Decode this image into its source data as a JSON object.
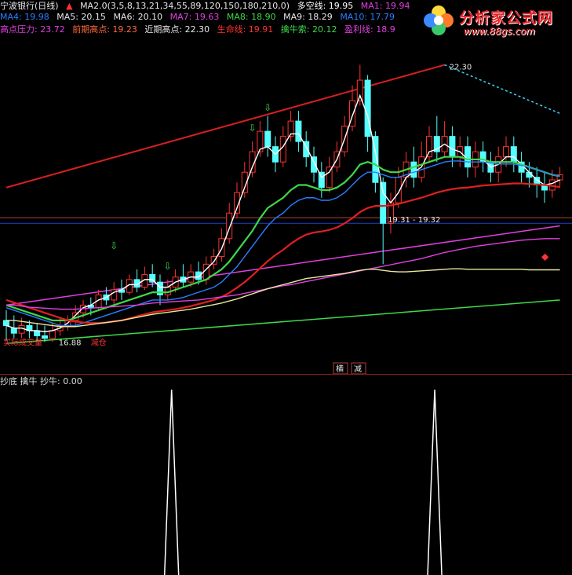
{
  "header": {
    "stock_title": "宁波银行(日线)",
    "indicator_name": "MA2.0(3,5,8,13,21,34,55,89,120,150,180,210,0)",
    "duokong": "多空线: 19.95",
    "ma1": "MA1: 19.94",
    "ma4": "MA4: 19.98",
    "ma5": "MA5: 20.15",
    "ma6": "MA6: 20.10",
    "ma7": "MA7: 19.63",
    "ma8": "MA8: 18.90",
    "ma9": "MA9: 18.29",
    "ma10": "MA10: 17.79",
    "gaodian": "高点压力: 23.72",
    "qiqi": "前期高点: 19.23",
    "jinqi": "近期高点: 22.30",
    "shengming": "生命线: 19.91",
    "qinniusuo": "擒牛索: 20.12",
    "yingli": "盈利线: 18.9"
  },
  "annotations": {
    "peak_label": "22.30",
    "range_label": "19.31 - 19.32",
    "low_label": "16.88",
    "left_tag": "实际成交量",
    "right_tag": "减仓",
    "bottom_left_box": "横",
    "bottom_right_box": "减"
  },
  "subpanel": {
    "title": "抄底 擒牛 抄牛: 0.00"
  },
  "logo": {
    "title": "分析家公式网",
    "url": "www.88gs.com"
  },
  "colors": {
    "up": "#ff3232",
    "down": "#54ffff",
    "ma_white": "#ffffff",
    "ma_green": "#3fd84a",
    "ma_red": "#e02020",
    "ma_blue": "#2a7fff",
    "ma_magenta": "#e040e0",
    "ma_yellow": "#e8e8a0"
  },
  "chart_data": {
    "type": "candlestick",
    "title": "宁波银行(日线)",
    "price_range": [
      16.5,
      22.8
    ],
    "candles": [
      [
        17.3,
        17.2,
        17.5,
        16.9
      ],
      [
        17.15,
        17.05,
        17.4,
        16.95
      ],
      [
        17.05,
        17.2,
        17.35,
        16.95
      ],
      [
        17.2,
        17.1,
        17.3,
        16.95
      ],
      [
        17.1,
        17.0,
        17.25,
        16.9
      ],
      [
        17.0,
        16.95,
        17.2,
        16.88
      ],
      [
        16.95,
        17.1,
        17.25,
        16.88
      ],
      [
        17.1,
        17.2,
        17.35,
        17.0
      ],
      [
        17.2,
        17.3,
        17.4,
        17.1
      ],
      [
        17.3,
        17.45,
        17.6,
        17.2
      ],
      [
        17.45,
        17.6,
        17.7,
        17.35
      ],
      [
        17.6,
        17.55,
        17.75,
        17.4
      ],
      [
        17.55,
        17.8,
        17.9,
        17.5
      ],
      [
        17.8,
        17.7,
        17.95,
        17.6
      ],
      [
        17.7,
        17.9,
        18.05,
        17.6
      ],
      [
        17.9,
        17.85,
        18.1,
        17.7
      ],
      [
        17.85,
        18.1,
        18.2,
        17.8
      ],
      [
        18.1,
        17.95,
        18.3,
        17.85
      ],
      [
        17.95,
        18.2,
        18.35,
        17.9
      ],
      [
        18.2,
        18.05,
        18.4,
        17.95
      ],
      [
        18.05,
        17.8,
        18.2,
        17.6
      ],
      [
        17.8,
        17.95,
        18.1,
        17.7
      ],
      [
        17.95,
        18.15,
        18.3,
        17.85
      ],
      [
        18.15,
        18.05,
        18.4,
        17.95
      ],
      [
        18.05,
        18.25,
        18.4,
        17.95
      ],
      [
        18.25,
        18.1,
        18.45,
        18.0
      ],
      [
        18.1,
        18.4,
        18.55,
        18.0
      ],
      [
        18.4,
        18.55,
        18.7,
        18.3
      ],
      [
        18.55,
        18.9,
        19.1,
        18.45
      ],
      [
        18.9,
        19.4,
        19.6,
        18.8
      ],
      [
        19.4,
        19.8,
        20.0,
        19.3
      ],
      [
        19.8,
        20.2,
        20.4,
        19.7
      ],
      [
        20.2,
        20.6,
        20.8,
        20.1
      ],
      [
        20.6,
        21.0,
        21.2,
        20.5
      ],
      [
        21.0,
        20.7,
        21.3,
        20.5
      ],
      [
        20.7,
        20.4,
        20.9,
        20.2
      ],
      [
        20.4,
        20.9,
        21.1,
        20.3
      ],
      [
        20.9,
        21.2,
        21.4,
        20.8
      ],
      [
        21.2,
        20.8,
        21.4,
        20.6
      ],
      [
        20.8,
        20.5,
        21.0,
        20.3
      ],
      [
        20.5,
        20.2,
        20.7,
        20.0
      ],
      [
        20.2,
        19.9,
        20.4,
        19.7
      ],
      [
        19.9,
        20.3,
        20.5,
        19.8
      ],
      [
        20.3,
        20.6,
        20.8,
        20.2
      ],
      [
        20.6,
        21.1,
        21.3,
        20.5
      ],
      [
        21.1,
        21.6,
        21.9,
        21.0
      ],
      [
        21.6,
        22.0,
        22.3,
        21.5
      ],
      [
        22.0,
        20.9,
        22.1,
        20.6
      ],
      [
        20.9,
        20.0,
        21.0,
        19.8
      ],
      [
        20.0,
        19.2,
        20.1,
        18.4
      ],
      [
        19.2,
        19.6,
        19.8,
        19.0
      ],
      [
        19.6,
        20.1,
        20.3,
        19.5
      ],
      [
        20.1,
        20.4,
        20.6,
        19.9
      ],
      [
        20.4,
        20.1,
        20.7,
        19.9
      ],
      [
        20.1,
        20.5,
        20.8,
        20.0
      ],
      [
        20.5,
        20.9,
        21.1,
        20.4
      ],
      [
        20.9,
        20.6,
        21.3,
        20.4
      ],
      [
        20.6,
        20.9,
        21.2,
        20.5
      ],
      [
        20.9,
        20.5,
        21.1,
        20.3
      ],
      [
        20.5,
        20.7,
        20.9,
        20.3
      ],
      [
        20.7,
        20.3,
        20.9,
        20.1
      ],
      [
        20.3,
        20.6,
        20.8,
        20.1
      ],
      [
        20.6,
        20.4,
        20.8,
        20.2
      ],
      [
        20.4,
        20.2,
        20.6,
        20.0
      ],
      [
        20.2,
        20.5,
        20.7,
        20.0
      ],
      [
        20.5,
        20.7,
        20.9,
        20.3
      ],
      [
        20.7,
        20.4,
        20.9,
        20.2
      ],
      [
        20.4,
        20.2,
        20.6,
        20.0
      ],
      [
        20.2,
        20.1,
        20.4,
        19.9
      ],
      [
        20.1,
        19.95,
        20.3,
        19.7
      ],
      [
        19.95,
        19.85,
        20.2,
        19.6
      ],
      [
        19.85,
        20.05,
        20.25,
        19.7
      ],
      [
        20.05,
        20.15,
        20.3,
        19.9
      ]
    ],
    "series": [
      {
        "name": "多空线",
        "color": "#ffffff",
        "values": [
          17.2,
          17.15,
          17.15,
          17.1,
          17.1,
          17.08,
          17.1,
          17.15,
          17.25,
          17.4,
          17.55,
          17.6,
          17.7,
          17.75,
          17.85,
          17.9,
          18.0,
          18.0,
          18.1,
          18.1,
          17.95,
          17.95,
          18.05,
          18.1,
          18.15,
          18.15,
          18.3,
          18.45,
          18.7,
          19.1,
          19.5,
          19.9,
          20.3,
          20.65,
          20.7,
          20.55,
          20.7,
          20.95,
          20.95,
          20.7,
          20.4,
          20.1,
          20.2,
          20.45,
          20.85,
          21.3,
          21.7,
          21.3,
          20.6,
          19.8,
          19.6,
          19.8,
          20.1,
          20.2,
          20.3,
          20.6,
          20.65,
          20.75,
          20.65,
          20.6,
          20.45,
          20.45,
          20.45,
          20.3,
          20.35,
          20.5,
          20.5,
          20.35,
          20.2,
          20.05,
          19.95,
          19.98,
          20.05
        ]
      },
      {
        "name": "擒牛索",
        "color": "#3fd84a",
        "values": [
          17.6,
          17.55,
          17.5,
          17.45,
          17.4,
          17.35,
          17.3,
          17.3,
          17.3,
          17.35,
          17.4,
          17.45,
          17.5,
          17.55,
          17.6,
          17.65,
          17.7,
          17.75,
          17.8,
          17.85,
          17.85,
          17.85,
          17.9,
          17.95,
          18.0,
          18.05,
          18.1,
          18.2,
          18.3,
          18.45,
          18.65,
          18.85,
          19.05,
          19.3,
          19.5,
          19.6,
          19.7,
          19.85,
          19.95,
          19.95,
          19.9,
          19.85,
          19.85,
          19.9,
          20.0,
          20.15,
          20.35,
          20.4,
          20.35,
          20.25,
          20.2,
          20.2,
          20.25,
          20.3,
          20.35,
          20.4,
          20.45,
          20.5,
          20.5,
          20.5,
          20.45,
          20.45,
          20.45,
          20.4,
          20.4,
          20.4,
          20.4,
          20.35,
          20.3,
          20.25,
          20.2,
          20.15,
          20.12
        ]
      },
      {
        "name": "MA10",
        "color": "#2a7fff",
        "values": [
          17.55,
          17.5,
          17.45,
          17.4,
          17.35,
          17.3,
          17.25,
          17.2,
          17.2,
          17.2,
          17.25,
          17.3,
          17.35,
          17.4,
          17.45,
          17.5,
          17.55,
          17.6,
          17.65,
          17.7,
          17.7,
          17.7,
          17.72,
          17.75,
          17.8,
          17.85,
          17.9,
          17.95,
          18.05,
          18.2,
          18.35,
          18.55,
          18.75,
          18.95,
          19.15,
          19.3,
          19.4,
          19.55,
          19.65,
          19.7,
          19.7,
          19.65,
          19.65,
          19.7,
          19.8,
          19.95,
          20.1,
          20.2,
          20.2,
          20.15,
          20.1,
          20.1,
          20.15,
          20.2,
          20.25,
          20.3,
          20.35,
          20.4,
          20.42,
          20.42,
          20.4,
          20.4,
          20.4,
          20.38,
          20.36,
          20.36,
          20.36,
          20.33,
          20.3,
          20.25,
          20.2,
          20.15,
          20.12
        ]
      },
      {
        "name": "生命线",
        "color": "#e02020",
        "values": [
          17.7,
          17.65,
          17.6,
          17.55,
          17.5,
          17.45,
          17.4,
          17.35,
          17.3,
          17.28,
          17.26,
          17.25,
          17.25,
          17.26,
          17.28,
          17.3,
          17.34,
          17.38,
          17.42,
          17.46,
          17.48,
          17.5,
          17.52,
          17.55,
          17.58,
          17.62,
          17.66,
          17.7,
          17.76,
          17.84,
          17.94,
          18.05,
          18.18,
          18.32,
          18.46,
          18.58,
          18.68,
          18.8,
          18.9,
          18.98,
          19.02,
          19.04,
          19.07,
          19.12,
          19.2,
          19.3,
          19.42,
          19.5,
          19.54,
          19.54,
          19.55,
          19.58,
          19.62,
          19.66,
          19.7,
          19.75,
          19.8,
          19.84,
          19.87,
          19.89,
          19.9,
          19.92,
          19.94,
          19.95,
          19.96,
          19.97,
          19.98,
          19.98,
          19.97,
          19.96,
          19.95,
          19.93,
          19.91
        ]
      },
      {
        "name": "盈利线",
        "color": "#e040e0",
        "values": [
          17.6,
          17.6,
          17.58,
          17.56,
          17.55,
          17.54,
          17.53,
          17.52,
          17.52,
          17.52,
          17.53,
          17.54,
          17.55,
          17.56,
          17.57,
          17.58,
          17.59,
          17.6,
          17.62,
          17.64,
          17.65,
          17.66,
          17.67,
          17.68,
          17.69,
          17.7,
          17.72,
          17.74,
          17.76,
          17.78,
          17.8,
          17.83,
          17.86,
          17.89,
          17.92,
          17.95,
          17.98,
          18.0,
          18.03,
          18.06,
          18.09,
          18.12,
          18.15,
          18.18,
          18.21,
          18.24,
          18.27,
          18.3,
          18.33,
          18.36,
          18.39,
          18.42,
          18.45,
          18.48,
          18.51,
          18.55,
          18.59,
          18.63,
          18.66,
          18.69,
          18.72,
          18.75,
          18.77,
          18.79,
          18.81,
          18.83,
          18.85,
          18.87,
          18.88,
          18.89,
          18.9,
          18.9,
          18.9
        ]
      },
      {
        "name": "MA9",
        "color": "#e8e8a0",
        "values": [
          17.3,
          17.3,
          17.28,
          17.26,
          17.24,
          17.22,
          17.2,
          17.18,
          17.18,
          17.18,
          17.2,
          17.22,
          17.24,
          17.26,
          17.28,
          17.3,
          17.33,
          17.36,
          17.39,
          17.42,
          17.44,
          17.46,
          17.48,
          17.5,
          17.52,
          17.55,
          17.58,
          17.61,
          17.64,
          17.68,
          17.72,
          17.77,
          17.82,
          17.87,
          17.92,
          17.96,
          18.0,
          18.04,
          18.08,
          18.12,
          18.14,
          18.16,
          18.18,
          18.2,
          18.22,
          18.25,
          18.28,
          18.3,
          18.3,
          18.28,
          18.26,
          18.25,
          18.25,
          18.26,
          18.27,
          18.28,
          18.29,
          18.3,
          18.31,
          18.31,
          18.3,
          18.3,
          18.3,
          18.3,
          18.3,
          18.3,
          18.3,
          18.3,
          18.29,
          18.29,
          18.29,
          18.29,
          18.29
        ]
      }
    ],
    "long_lines": [
      {
        "name": "高点压力",
        "color": "#d42020",
        "from": [
          0,
          19.9
        ],
        "to": [
          57,
          22.3
        ]
      },
      {
        "name": "阻力虚线",
        "color": "#40d0ff",
        "from": [
          57,
          22.3
        ],
        "to": [
          72,
          21.35
        ]
      },
      {
        "name": "紫色长线",
        "color": "#e040e0",
        "from": [
          0,
          17.6
        ],
        "to": [
          72,
          19.15
        ]
      },
      {
        "name": "绿色长线",
        "color": "#3fd84a",
        "from": [
          0,
          16.85
        ],
        "to": [
          72,
          17.7
        ]
      }
    ],
    "subpanel": {
      "title": "抄底 擒牛 抄牛: 0.00",
      "spikes": [
        30,
        76
      ]
    }
  }
}
